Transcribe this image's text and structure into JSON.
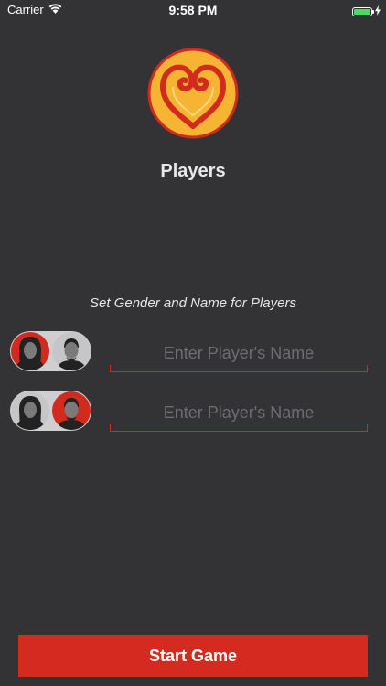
{
  "status_bar": {
    "carrier": "Carrier",
    "time": "9:58 PM",
    "battery_level": 1.0,
    "battery_color": "#4cd964"
  },
  "header": {
    "logo_icon": "heart-swirl-logo",
    "title": "Players"
  },
  "main": {
    "instruction": "Set Gender and Name for Players",
    "players": [
      {
        "selected_gender": "female",
        "name_value": "",
        "name_placeholder": "Enter Player's Name"
      },
      {
        "selected_gender": "male",
        "name_value": "",
        "name_placeholder": "Enter Player's Name"
      }
    ]
  },
  "footer": {
    "start_label": "Start Game"
  },
  "colors": {
    "background": "#333336",
    "accent": "#d32a1f",
    "logo_fill": "#f5b532",
    "placeholder": "#6d6d72"
  }
}
